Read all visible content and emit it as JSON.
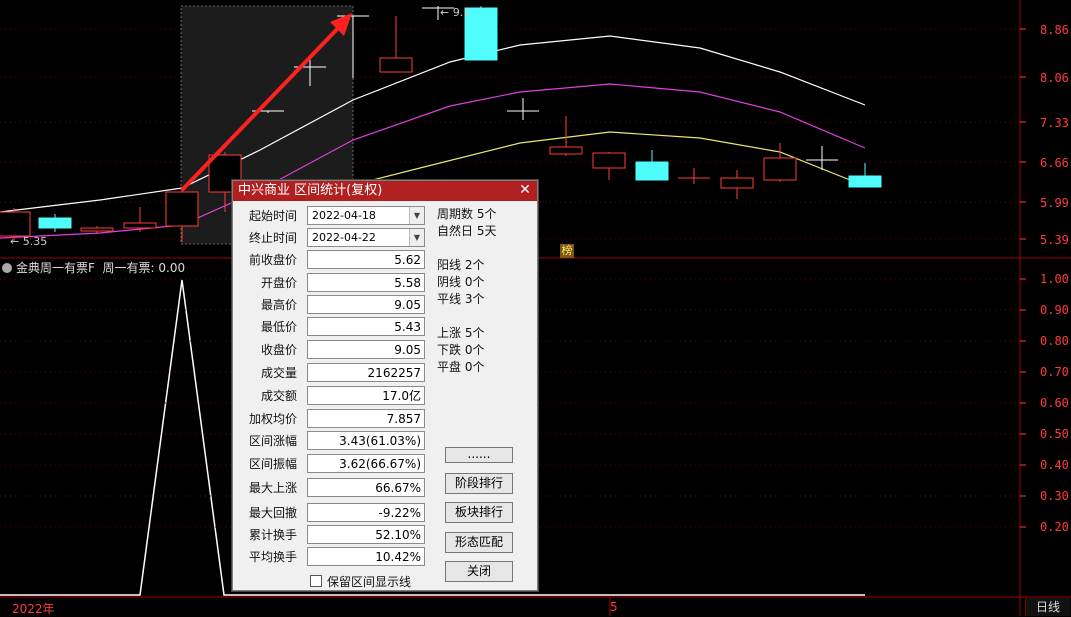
{
  "main_chart": {
    "price_axis": [
      "8.86",
      "8.06",
      "7.33",
      "6.66",
      "5.99",
      "5.39"
    ],
    "low_marker": "← 5.35",
    "high_marker": "← 9.1",
    "mark_badge": "榜"
  },
  "indicator": {
    "name": "金典周一有票F",
    "value_label": "周一有票: 0.00",
    "axis": [
      "1.00",
      "0.90",
      "0.80",
      "0.70",
      "0.60",
      "0.50",
      "0.40",
      "0.30",
      "0.20"
    ]
  },
  "bottom": {
    "year": "2022年",
    "mid_marker": "5",
    "period": "日线"
  },
  "dialog": {
    "title": "中兴商业 区间统计(复权)",
    "start_label": "起始时间",
    "start_value": "2022-04-18",
    "end_label": "终止时间",
    "end_value": "2022-04-22",
    "fields": [
      {
        "label": "前收盘价",
        "value": "5.62"
      },
      {
        "label": "开盘价",
        "value": "5.58"
      },
      {
        "label": "最高价",
        "value": "9.05"
      },
      {
        "label": "最低价",
        "value": "5.43"
      },
      {
        "label": "收盘价",
        "value": "9.05"
      },
      {
        "label": "成交量",
        "value": "2162257"
      },
      {
        "label": "成交额",
        "value": "17.0亿"
      },
      {
        "label": "加权均价",
        "value": "7.857"
      },
      {
        "label": "区间涨幅",
        "value": "3.43(61.03%)"
      },
      {
        "label": "区间振幅",
        "value": "3.62(66.67%)"
      },
      {
        "label": "最大上涨",
        "value": "66.67%"
      },
      {
        "label": "最大回撤",
        "value": "-9.22%"
      },
      {
        "label": "累计换手",
        "value": "52.10%"
      },
      {
        "label": "平均换手",
        "value": "10.42%"
      }
    ],
    "stats": {
      "periods": "周期数 5个",
      "natural_days": "自然日 5天",
      "yang": "阳线 2个",
      "yin": "阴线 0个",
      "flat": "平线 3个",
      "up": "上涨 5个",
      "down": "下跌 0个",
      "even": "平盘 0个"
    },
    "buttons": {
      "more": "......",
      "stage_rank": "阶段排行",
      "sector_rank": "板块排行",
      "pattern_match": "形态匹配",
      "close": "关闭"
    },
    "keep_lines": "保留区间显示线"
  },
  "colors": {
    "up_candle": "#ff3b3b",
    "down_candle": "#4ffcfc",
    "ma_white": "#ffffff",
    "ma_magenta": "#e040e0",
    "ma_yellow": "#e8e870",
    "arrow": "#ff2020",
    "grid": "#7a0000"
  }
}
